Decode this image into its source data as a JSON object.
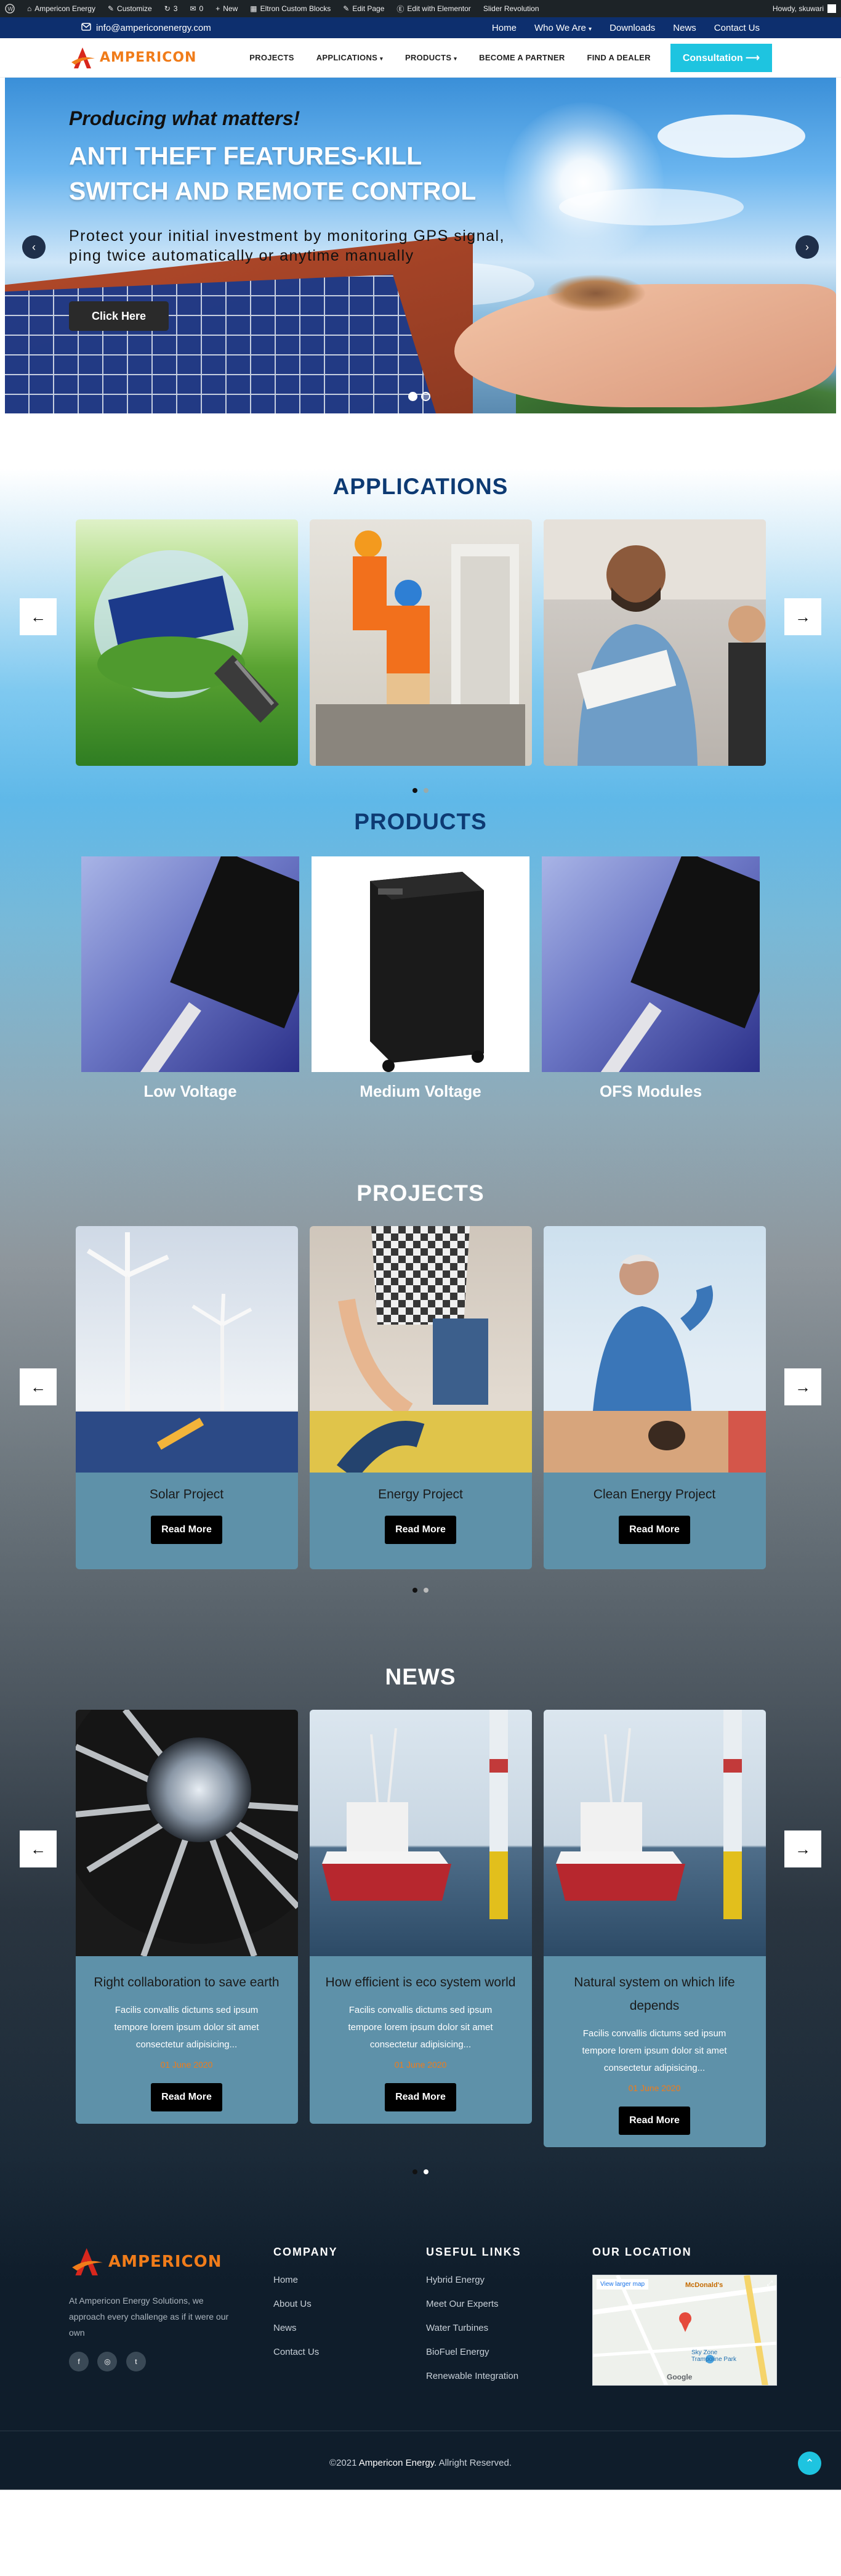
{
  "adminbar": {
    "site_name": "Ampericon Energy",
    "customize": "Customize",
    "comments_count": "0",
    "updates_count": "3",
    "new_label": "New",
    "custom_blocks": "Eltron Custom Blocks",
    "edit_page": "Edit Page",
    "edit_elementor": "Edit with Elementor",
    "slider_rev": "Slider Revolution",
    "howdy": "Howdy, skuwari"
  },
  "topbar": {
    "email": "info@ampericonenergy.com",
    "nav": [
      "Home",
      "Who We Are",
      "Downloads",
      "News",
      "Contact Us"
    ]
  },
  "header": {
    "logo_text": "AMPERICON",
    "nav": [
      "PROJECTS",
      "APPLICATIONS",
      "PRODUCTS",
      "BECOME A PARTNER",
      "FIND A DEALER"
    ],
    "cta": "Consultation ⟶"
  },
  "hero": {
    "tagline": "Producing what matters!",
    "title_line1": "ANTI THEFT FEATURES-KILL",
    "title_line2": "SWITCH AND REMOTE CONTROL",
    "desc_line1": "Protect your initial investment by monitoring GPS signal,",
    "desc_line2": "ping twice automatically or anytime manually",
    "button": "Click Here",
    "slide_count": 2,
    "active_slide": 1
  },
  "applications": {
    "title": "APPLICATIONS"
  },
  "products": {
    "title": "PRODUCTS",
    "items": [
      "Low Voltage",
      "Medium Voltage",
      "OFS Modules"
    ]
  },
  "projects": {
    "title": "PROJECTS",
    "items": [
      {
        "title": "Solar Project",
        "button": "Read More"
      },
      {
        "title": "Energy Project",
        "button": "Read More"
      },
      {
        "title": "Clean Energy Project",
        "button": "Read More"
      }
    ]
  },
  "news": {
    "title": "NEWS",
    "items": [
      {
        "title": "Right collaboration to save earth",
        "excerpt": "Facilis convallis dictums sed ipsum tempore lorem ipsum dolor sit amet consectetur adipisicing...",
        "date": "01 June 2020",
        "button": "Read More"
      },
      {
        "title": "How efficient is eco system world",
        "excerpt": "Facilis convallis dictums sed ipsum tempore lorem ipsum dolor sit amet consectetur adipisicing...",
        "date": "01 June 2020",
        "button": "Read More"
      },
      {
        "title": "Natural system on which life depends",
        "excerpt": "Facilis convallis dictums sed ipsum tempore lorem ipsum dolor sit amet consectetur adipisicing...",
        "date": "01 June 2020",
        "button": "Read More"
      }
    ]
  },
  "footer": {
    "logo_text": "AMPERICON",
    "about": "At Ampericon Energy Solutions, we approach every challenge as if it were our own",
    "company_title": "COMPANY",
    "company_links": [
      "Home",
      "About Us",
      "News",
      "Contact Us"
    ],
    "useful_title": "USEFUL LINKS",
    "useful_links": [
      "Hybrid Energy",
      "Meet Our Experts",
      "Water Turbines",
      "BioFuel Energy",
      "Renewable Integration"
    ],
    "location_title": "OUR LOCATION",
    "map_link": "View larger map",
    "map_label_1": "McDonald's",
    "map_label_2": "Sky Zone Trampoline Park",
    "map_label_3": "Google",
    "copyright_prefix": "©2021",
    "copyright_brand": "Ampericon Energy.",
    "copyright_suffix": "Allright Reserved."
  },
  "colors": {
    "navy": "#0d2f6e",
    "accent": "#1ec4e0",
    "brand_orange": "#f07c1a",
    "card_blue": "#5e91a9",
    "title_blue": "#0d3a73"
  }
}
